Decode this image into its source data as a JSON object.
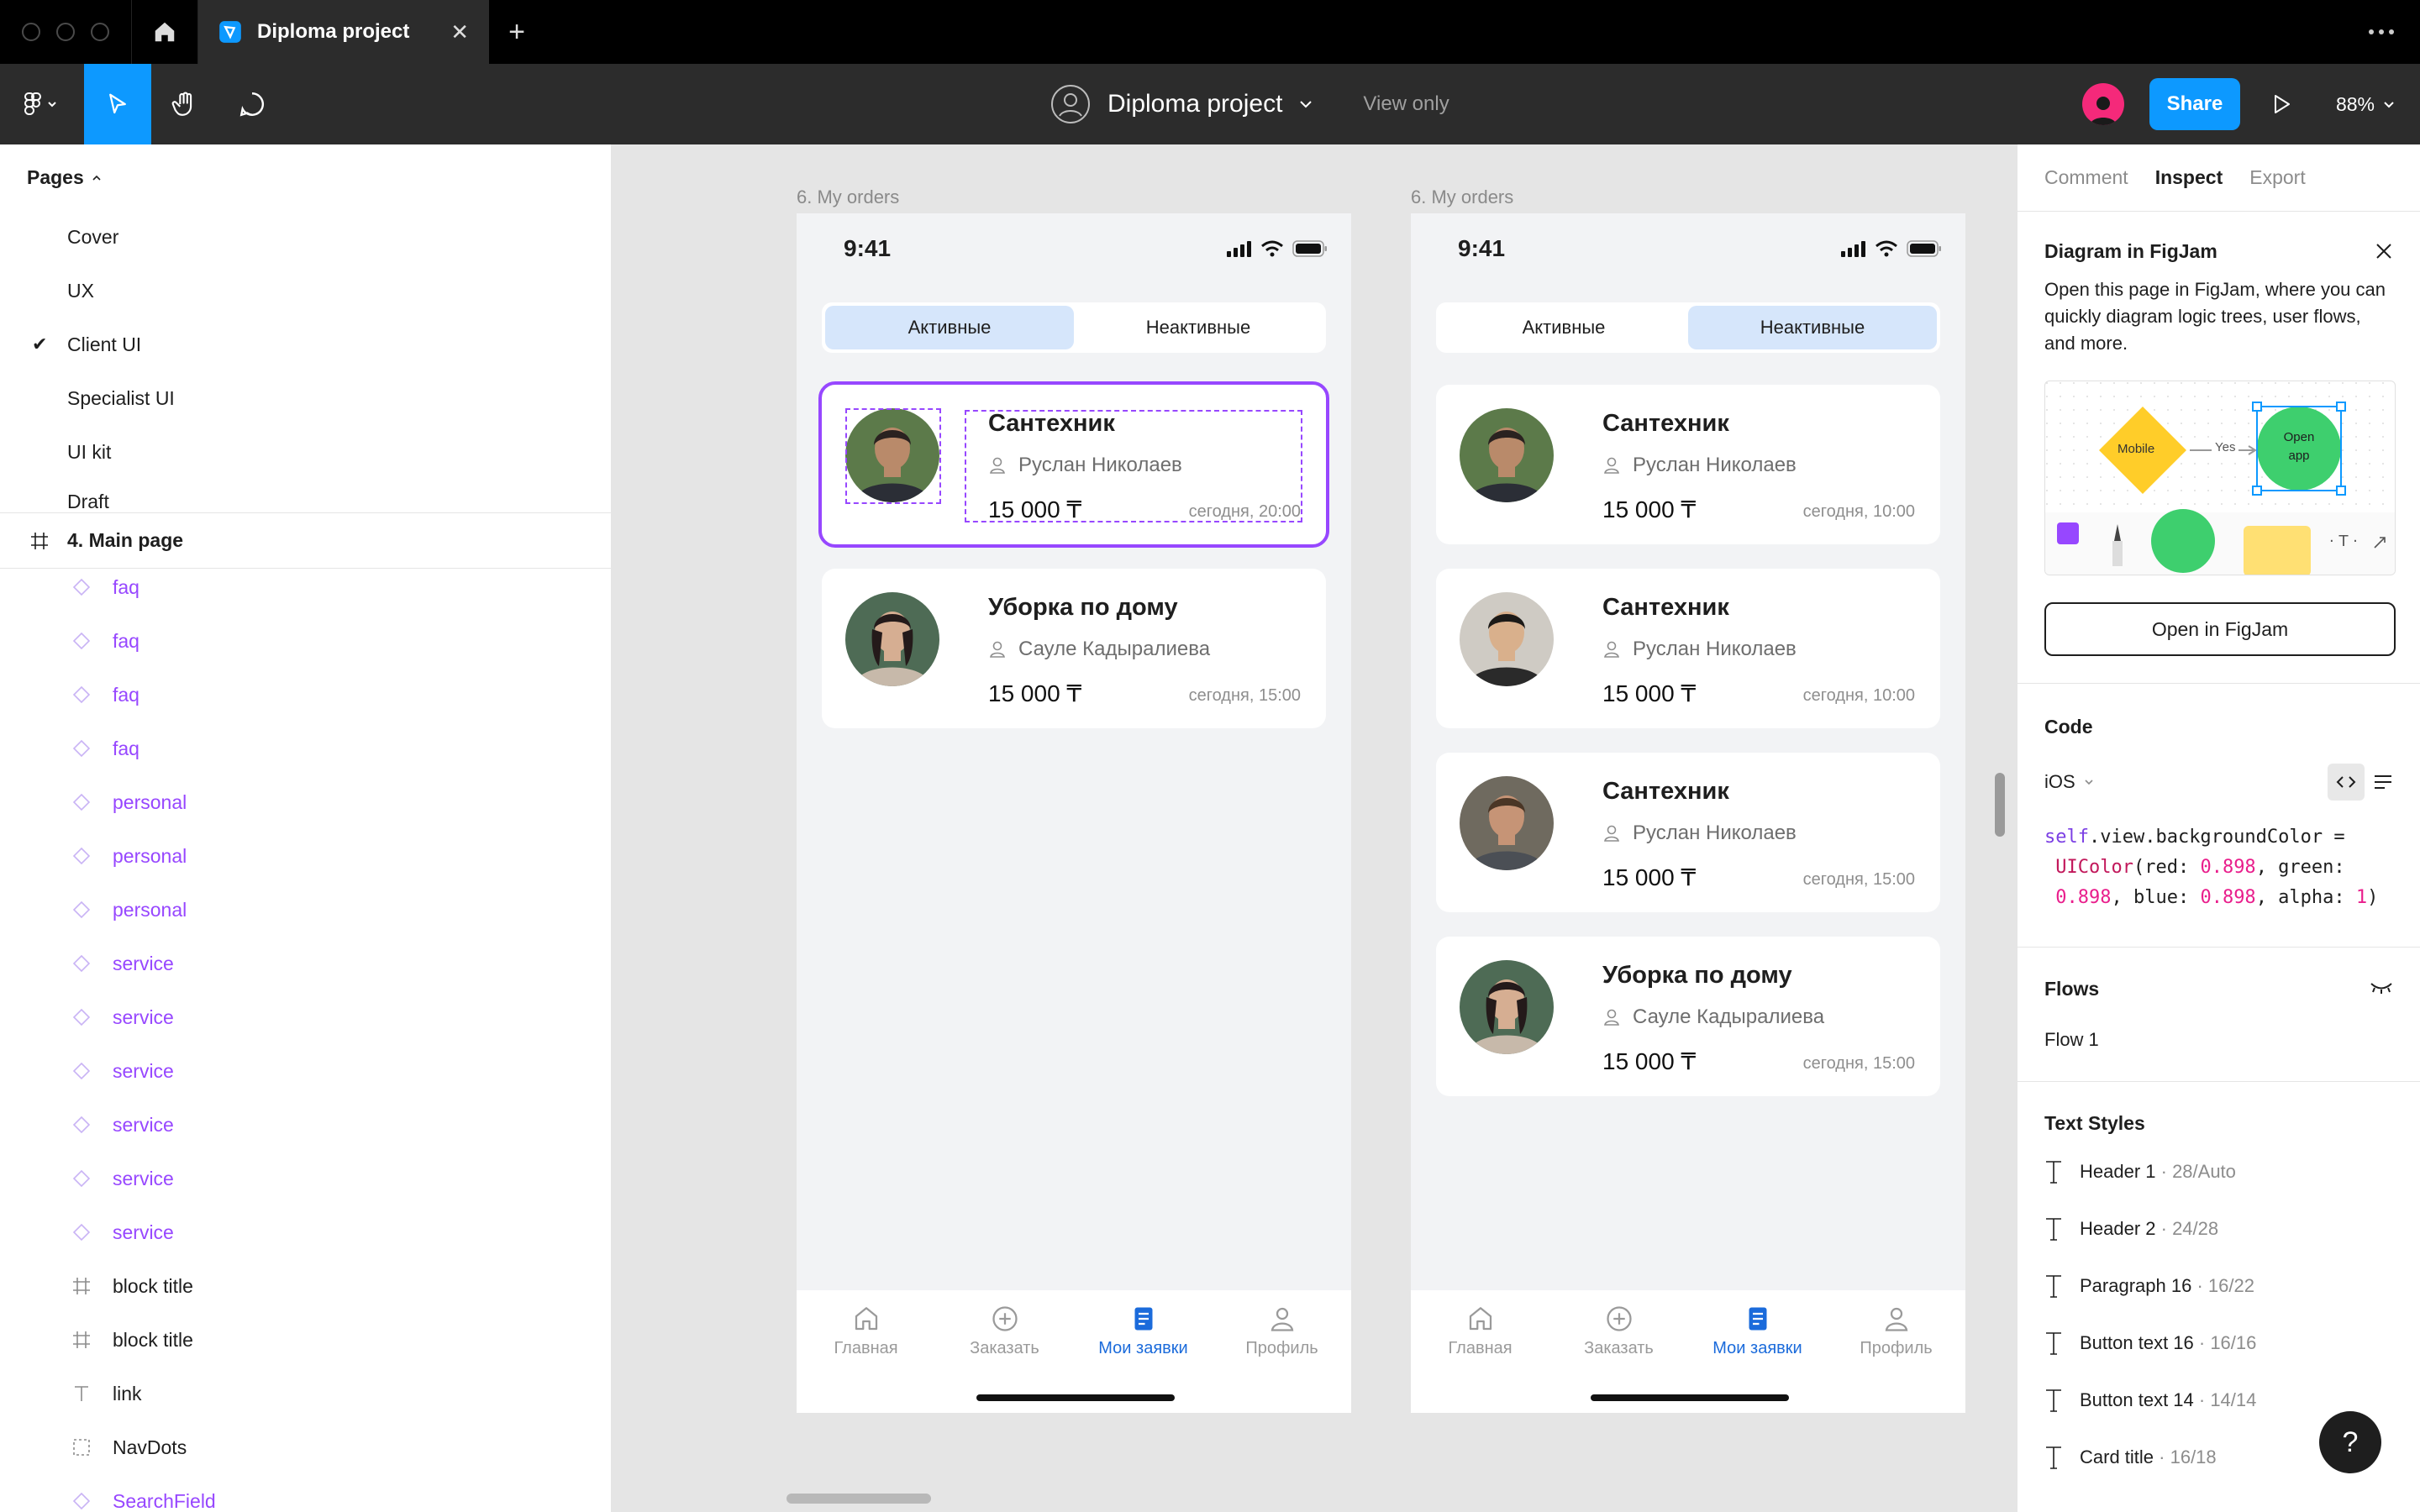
{
  "titlebar": {
    "tab_title": "Diploma project",
    "tab_close": "✕",
    "new_tab": "+"
  },
  "toolbar": {
    "file_name": "Diploma project",
    "view_only": "View only",
    "share_label": "Share",
    "zoom": "88%"
  },
  "left_panel": {
    "pages_title": "Pages",
    "pages": [
      {
        "label": "Cover",
        "checked": false
      },
      {
        "label": "UX",
        "checked": false
      },
      {
        "label": "Client UI",
        "checked": true
      },
      {
        "label": "Specialist UI",
        "checked": false
      },
      {
        "label": "UI kit",
        "checked": false
      },
      {
        "label": "Draft",
        "checked": false
      }
    ],
    "current_frame": "4. Main page",
    "layers": [
      {
        "label": "faq",
        "type": "component"
      },
      {
        "label": "faq",
        "type": "component"
      },
      {
        "label": "faq",
        "type": "component"
      },
      {
        "label": "faq",
        "type": "component"
      },
      {
        "label": "personal",
        "type": "component"
      },
      {
        "label": "personal",
        "type": "component"
      },
      {
        "label": "personal",
        "type": "component"
      },
      {
        "label": "service",
        "type": "component"
      },
      {
        "label": "service",
        "type": "component"
      },
      {
        "label": "service",
        "type": "component"
      },
      {
        "label": "service",
        "type": "component"
      },
      {
        "label": "service",
        "type": "component"
      },
      {
        "label": "service",
        "type": "component"
      },
      {
        "label": "block title",
        "type": "frame"
      },
      {
        "label": "block title",
        "type": "frame"
      },
      {
        "label": "link",
        "type": "text"
      },
      {
        "label": "NavDots",
        "type": "group"
      },
      {
        "label": "SearchField",
        "type": "component"
      }
    ]
  },
  "canvas": {
    "frames": [
      {
        "label": "6. My orders",
        "time": "9:41",
        "segments": [
          "Активные",
          "Неактивные"
        ],
        "active_segment": 0,
        "cards": [
          {
            "title": "Сантехник",
            "person": "Руслан Николаев",
            "price": "15 000 ₸",
            "time": "сегодня, 20:00",
            "photo": "man-1"
          },
          {
            "title": "Уборка по дому",
            "person": "Сауле Кадыралиева",
            "price": "15 000 ₸",
            "time": "сегодня, 15:00",
            "photo": "woman-1"
          }
        ]
      },
      {
        "label": "6. My orders",
        "time": "9:41",
        "segments": [
          "Активные",
          "Неактивные"
        ],
        "active_segment": 1,
        "cards": [
          {
            "title": "Сантехник",
            "person": "Руслан Николаев",
            "price": "15 000 ₸",
            "time": "сегодня, 10:00",
            "photo": "man-1"
          },
          {
            "title": "Сантехник",
            "person": "Руслан Николаев",
            "price": "15 000 ₸",
            "time": "сегодня, 10:00",
            "photo": "man-2"
          },
          {
            "title": "Сантехник",
            "person": "Руслан Николаев",
            "price": "15 000 ₸",
            "time": "сегодня, 15:00",
            "photo": "man-3"
          },
          {
            "title": "Уборка по дому",
            "person": "Сауле Кадыралиева",
            "price": "15 000 ₸",
            "time": "сегодня, 15:00",
            "photo": "woman-1"
          }
        ]
      }
    ],
    "tabbar": [
      {
        "label": "Главная",
        "icon": "home-icon"
      },
      {
        "label": "Заказать",
        "icon": "plus-circle-icon"
      },
      {
        "label": "Мои заявки",
        "icon": "document-icon",
        "active": true
      },
      {
        "label": "Профиль",
        "icon": "user-icon"
      }
    ]
  },
  "right_panel": {
    "tabs": [
      "Comment",
      "Inspect",
      "Export"
    ],
    "active_tab": "Inspect",
    "figjam": {
      "title": "Diagram in FigJam",
      "text": "Open this page in FigJam, where you can quickly diagram logic trees, user flows, and more.",
      "preview_mobile": "Mobile",
      "preview_yes": "Yes",
      "preview_open": "Open app",
      "button": "Open in FigJam"
    },
    "code": {
      "title": "Code",
      "platform": "iOS"
    },
    "flows": {
      "title": "Flows",
      "items": [
        "Flow 1"
      ]
    },
    "text_styles": {
      "title": "Text Styles",
      "items": [
        {
          "name": "Header 1",
          "meta": " · 28/Auto"
        },
        {
          "name": "Header 2",
          "meta": " · 24/28"
        },
        {
          "name": "Paragraph 16",
          "meta": " · 16/22"
        },
        {
          "name": "Button text 16",
          "meta": " · 16/16"
        },
        {
          "name": "Button text 14",
          "meta": " · 14/14"
        },
        {
          "name": "Card title",
          "meta": " · 16/18"
        }
      ]
    }
  },
  "help": "?"
}
